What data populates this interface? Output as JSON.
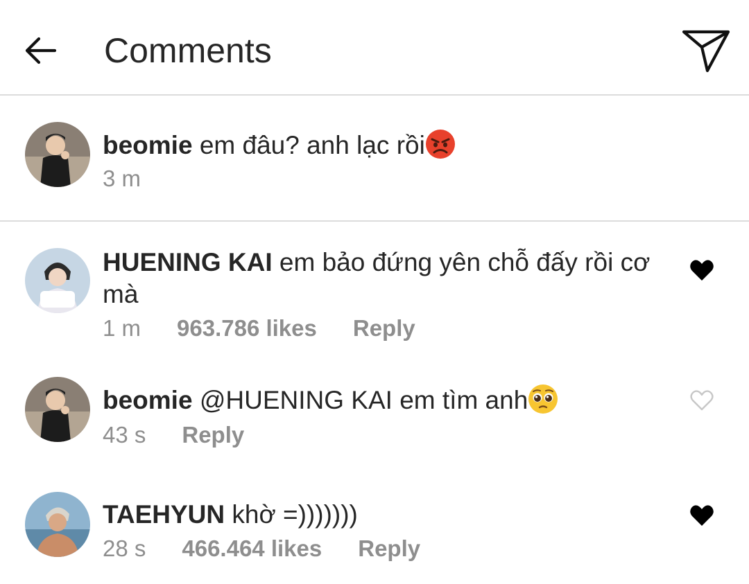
{
  "header": {
    "title": "Comments",
    "back_icon": "arrow-left-icon",
    "send_icon": "paper-plane-icon"
  },
  "caption": {
    "username": "beomie",
    "text": "em đâu? anh lạc rồi",
    "emoji": "angry-face-emoji",
    "time": "3 m"
  },
  "comments": [
    {
      "username": "HUENING KAI",
      "text": "em bảo đứng yên chỗ đấy rồi cơ mà",
      "time": "1 m",
      "likes": "963.786 likes",
      "reply": "Reply",
      "liked": true
    },
    {
      "username": "beomie",
      "text": "@HUENING KAI em tìm anh",
      "emoji": "pleading-face-emoji",
      "time": "43 s",
      "likes": "",
      "reply": "Reply",
      "liked": false
    },
    {
      "username": "TAEHYUN",
      "text": "khờ =)))))))",
      "time": "28 s",
      "likes": "466.464 likes",
      "reply": "Reply",
      "liked": true
    }
  ],
  "colors": {
    "text": "#262626",
    "muted": "#8e8e8e",
    "divider": "#dcdcdc",
    "heart_filled": "#000000",
    "heart_outline": "#c7c7c7"
  }
}
